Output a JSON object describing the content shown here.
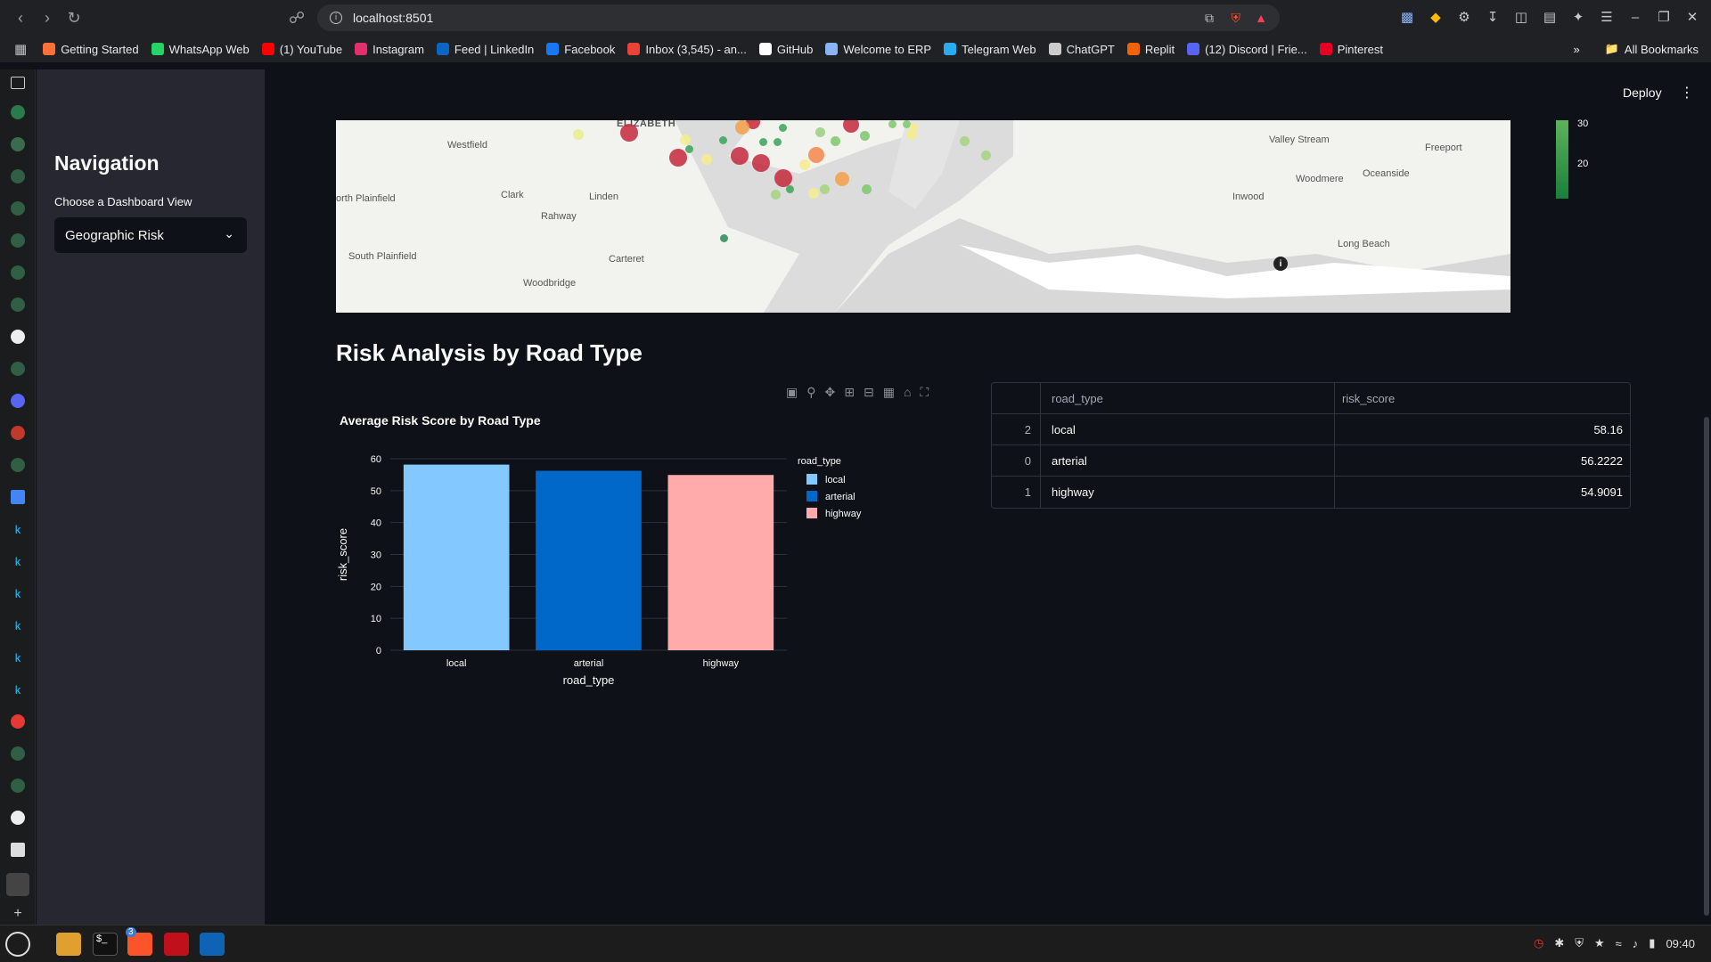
{
  "browser": {
    "url": "localhost:8501",
    "bookmarks": [
      {
        "label": "Getting Started",
        "color": "#ff7139"
      },
      {
        "label": "WhatsApp Web",
        "color": "#25d366"
      },
      {
        "label": "(1) YouTube",
        "color": "#ff0000"
      },
      {
        "label": "Instagram",
        "color": "#e1306c"
      },
      {
        "label": "Feed | LinkedIn",
        "color": "#0a66c2"
      },
      {
        "label": "Facebook",
        "color": "#1877f2"
      },
      {
        "label": "Inbox (3,545) - an...",
        "color": "#ea4335"
      },
      {
        "label": "GitHub",
        "color": "#ffffff"
      },
      {
        "label": "Welcome to ERP",
        "color": "#8ab4f8"
      },
      {
        "label": "Telegram Web",
        "color": "#2aabee"
      },
      {
        "label": "ChatGPT",
        "color": "#cccccc"
      },
      {
        "label": "Replit",
        "color": "#f26207"
      },
      {
        "label": "(12) Discord | Frie...",
        "color": "#5865f2"
      },
      {
        "label": "Pinterest",
        "color": "#e60023"
      }
    ],
    "all_bookmarks": "All Bookmarks"
  },
  "sidebar": {
    "title": "Navigation",
    "select_label": "Choose a Dashboard View",
    "select_value": "Geographic Risk"
  },
  "header": {
    "deploy": "Deploy"
  },
  "map": {
    "places": [
      "ELIZABETH",
      "Westfield",
      "Clark",
      "Linden",
      "orth Plainfield",
      "Rahway",
      "South Plainfield",
      "Carteret",
      "Woodbridge",
      "Valley Stream",
      "Freeport",
      "Oceanside",
      "Woodmere",
      "Inwood",
      "Long Beach"
    ],
    "colorbar_ticks": [
      "30",
      "20"
    ]
  },
  "section_title": "Risk Analysis by Road Type",
  "chart_data": {
    "type": "bar",
    "title": "Average Risk Score by Road Type",
    "categories": [
      "local",
      "arterial",
      "highway"
    ],
    "values": [
      58.16,
      56.2222,
      54.9091
    ],
    "colors": [
      "#83c9ff",
      "#0068c9",
      "#ffabab"
    ],
    "xlabel": "road_type",
    "ylabel": "risk_score",
    "ylim": [
      0,
      60
    ],
    "yticks": [
      0,
      10,
      20,
      30,
      40,
      50,
      60
    ],
    "legend_title": "road_type",
    "legend": [
      "local",
      "arterial",
      "highway"
    ],
    "legend_placement": "right",
    "grid": true
  },
  "table": {
    "columns": [
      "road_type",
      "risk_score"
    ],
    "rows": [
      {
        "index": "2",
        "road_type": "local",
        "risk_score": "58.16"
      },
      {
        "index": "0",
        "road_type": "arterial",
        "risk_score": "56.2222"
      },
      {
        "index": "1",
        "road_type": "highway",
        "risk_score": "54.9091"
      }
    ]
  },
  "taskbar": {
    "clock": "09:40",
    "badge": "3"
  }
}
